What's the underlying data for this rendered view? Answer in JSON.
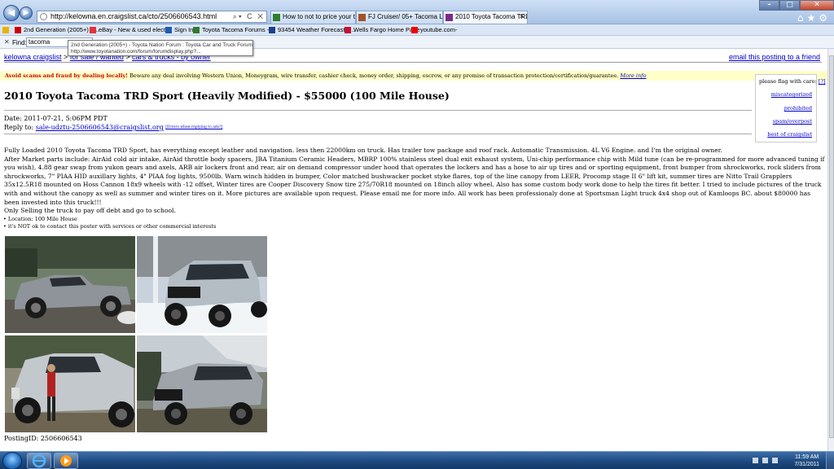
{
  "browser": {
    "address_url": "http://kelowna.en.craigslist.ca/cto/2506606543.html",
    "tabs": [
      {
        "label": "How to not to price your truck ..."
      },
      {
        "label": "FJ Cruiser/ 05+ Tacoma Long ..."
      },
      {
        "label": "2010 Toyota Tacoma TRD S..."
      }
    ],
    "favorites": [
      {
        "label": "2nd Generation (2005+) - ..."
      },
      {
        "label": "eBay - New & used electr..."
      },
      {
        "label": "Sign In"
      },
      {
        "label": "Toyota Tacoma Forums - ..."
      },
      {
        "label": "93454 Weather Forecast a..."
      },
      {
        "label": "Wells Fargo Home Page"
      },
      {
        "label": "youtube.com-"
      }
    ],
    "find": {
      "label": "Find:",
      "value": "tacoma"
    },
    "tooltip": {
      "line1": "2nd Generation (2005+) - Toyota Nation Forum : Toyota Car and Truck Forums",
      "line2": "http://www.toyotanation.com/forum/forumdisplay.php?..."
    }
  },
  "page": {
    "breadcrumbs": [
      {
        "label": "kelowna craigslist"
      },
      {
        "label": "for sale / wanted"
      },
      {
        "label": "cars & trucks - by owner"
      }
    ],
    "email_friend": "email this posting to a friend",
    "scam_warning": {
      "bold": "Avoid scams and fraud by dealing locally!",
      "text": "Beware any deal involving Western Union, Moneygram, wire transfer, cashier check, money order, shipping, escrow, or any promise of transaction protection/certification/guarantee.",
      "more": "More info"
    },
    "flag_box": {
      "heading": "please flag with care:",
      "help": "[?]",
      "links": [
        "miscategorized",
        "prohibited",
        "spam/overpost",
        "best of craigslist"
      ]
    },
    "title": "2010 Toyota Tacoma TRD Sport (Heavily Modified) - $55000 (100 Mile House)",
    "date": "Date: 2011-07-21, 5:06PM PDT",
    "reply_prefix": "Reply to:",
    "reply_email": "sale-udztu-2506606543@craigslist.org",
    "reply_errors": "[Errors when replying to ads?]",
    "body_p1": "Fully Loaded 2010 Toyota Tacoma TRD Sport, has everything except leather and navigation. less then 22000km on truck. Has trailer tow package and roof rack. Automatic Transmission. 4L V6 Engine. and I'm the original owner.",
    "body_p2": "After Market parts include: AirAid cold air intake, AirAid throttle body spacers, JBA Titanium Ceramic Headers, MBRP 100% stainless steel dual exit exhaust system, Uni-chip performance chip with Mild tune (can be re-programmed for more advanced tuning if you wish), 4.88 gear swap from yukon gears and axels, ARB air lockers front and rear, air on demand compressor under hood that operates the lockers and has a hose to air up tires and or sporting equipment, front bumper from shrockworks, rock sliders from shrockworks, 7\" PIAA HID auxillary lights, 4\" PIAA fog lights, 9500lb. Warn winch hidden in bumper, Color matched bushwacker pocket styke flares, top of the line canopy from LEER, Procomp stage II 6\" lift kit, summer tires are Nitto Trail Grapplers 35x12.5R18 mounted on Hoss Cannon 18x9 wheels with -12 offset, Winter tires are Cooper Discovery Snow tire 275/70R18 mounted on 18inch alloy wheel. Also has some custom body work done to help the tires fit better. I tried to include pictures of the truck with and without the canopy as well as summer and winter tires on it. More pictures are available upon request. Please email me for more info. All work has been professionaly done at Sportsman Light truck 4x4 shop out of Kamloops BC. about $80000 has been invested into this truck!!!",
    "body_p3": "Only Selling the truck to pay off debt and go to school.",
    "bullets": [
      "Location: 100 Mile House",
      "it's NOT ok to contact this poster with services or other commercial interests"
    ],
    "posting_id": "PostingID: 2506606543"
  },
  "taskbar": {
    "time": "11:59 AM",
    "date": "7/31/2011"
  }
}
